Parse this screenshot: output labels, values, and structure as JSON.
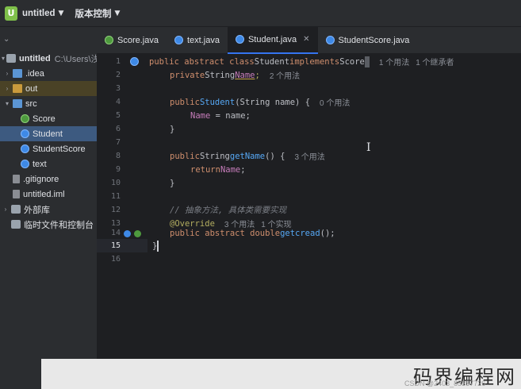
{
  "topbar": {
    "project_badge": "U",
    "project_name": "untitled",
    "vcs_label": "版本控制"
  },
  "sidebar": {
    "root_name": "untitled",
    "root_path": "C:\\Users\\浅池",
    "items": [
      {
        "label": ".idea"
      },
      {
        "label": "out"
      },
      {
        "label": "src"
      },
      {
        "label": "Score"
      },
      {
        "label": "Student"
      },
      {
        "label": "StudentScore"
      },
      {
        "label": "text"
      },
      {
        "label": ".gitignore"
      },
      {
        "label": "untitled.iml"
      },
      {
        "label": "外部库"
      },
      {
        "label": "临时文件和控制台"
      }
    ]
  },
  "tabs": [
    {
      "label": "Score.java"
    },
    {
      "label": "text.java"
    },
    {
      "label": "Student.java"
    },
    {
      "label": "StudentScore.java"
    }
  ],
  "code": {
    "line_numbers": [
      "1",
      "2",
      "3",
      "4",
      "5",
      "6",
      "7",
      "8",
      "9",
      "10",
      "11",
      "12",
      "13",
      "14",
      "15",
      "16"
    ],
    "l1": {
      "kw": "public abstract class",
      "name": "Student",
      "kw2": "implements",
      "iface": "Score",
      "hint1": "1 个用法",
      "hint2": "1 个继承者"
    },
    "l2": {
      "kw": "private",
      "type": "String",
      "field": "Name",
      "semi": ";",
      "hint": "2 个用法"
    },
    "l4": {
      "kw": "public",
      "name": "Student",
      "params": "(String name) {",
      "hint": "0 个用法"
    },
    "l5": {
      "field": "Name",
      "rest": " = name;"
    },
    "l6": {
      "text": "}"
    },
    "l8": {
      "kw": "public",
      "type": "String",
      "fn": "getName",
      "rest": "() {",
      "hint": "3 个用法"
    },
    "l9": {
      "kw": "return",
      "field": "Name",
      "semi": ";"
    },
    "l10": {
      "text": "}"
    },
    "l12": {
      "comment": "// 抽象方法, 具体类需要实现"
    },
    "l13": {
      "ann": "@Override",
      "hint1": "3 个用法",
      "hint2": "1 个实现"
    },
    "l14": {
      "kw": "public abstract double",
      "fn": "getcread",
      "rest": "();"
    },
    "l15": {
      "text": "}"
    }
  },
  "overlay": {
    "watermark": "码界编程网",
    "csdn": "CSDN @2403_85357726"
  },
  "colors": {
    "keyword": "#cf8e6d",
    "field": "#c77dbb",
    "function": "#56a8f5",
    "annotation": "#b3ae60",
    "accent": "#3574f0"
  }
}
